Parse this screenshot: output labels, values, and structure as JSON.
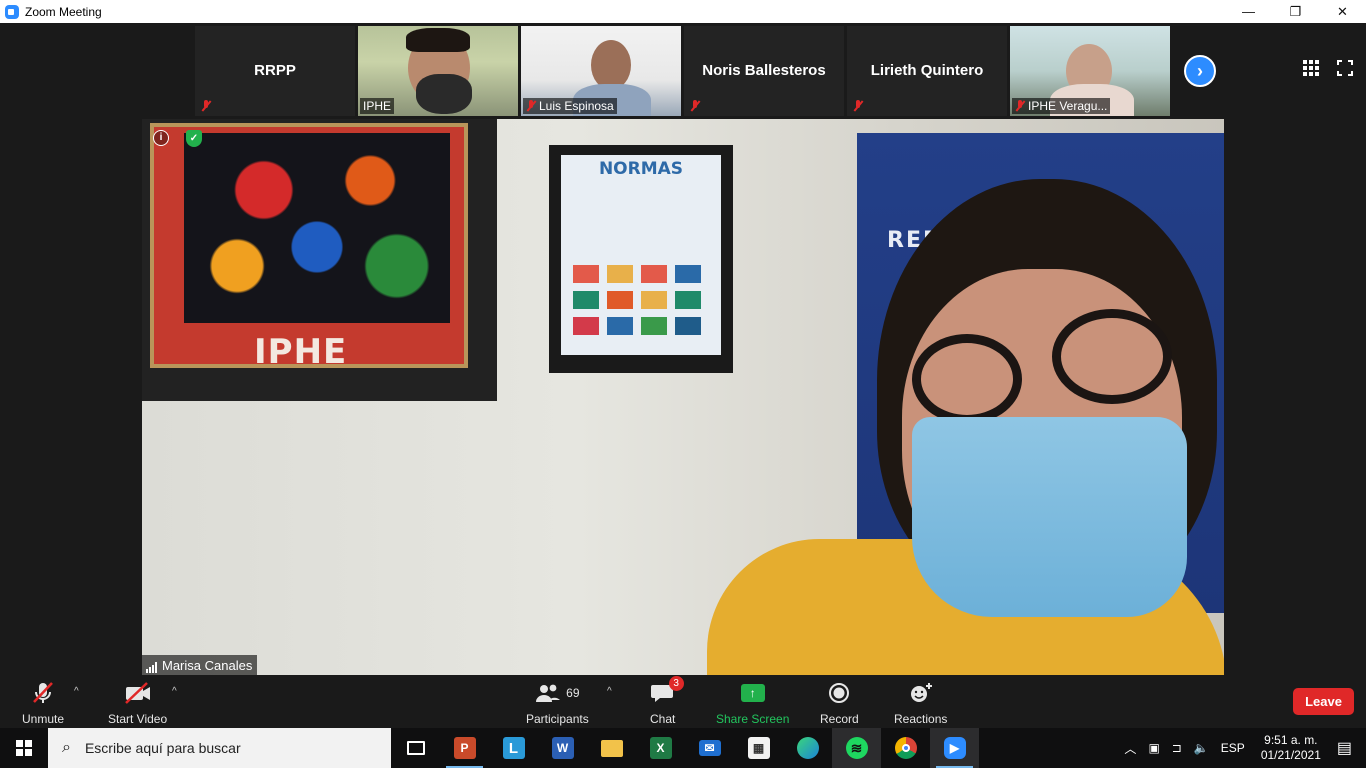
{
  "window": {
    "title": "Zoom Meeting",
    "controls": {
      "minimize": "—",
      "maximize": "❐",
      "close": "✕"
    }
  },
  "thumbnails": [
    {
      "name": "RRPP",
      "label": "",
      "video": false,
      "muted": true
    },
    {
      "name": "",
      "label": "IPHE",
      "video": true,
      "muted": false
    },
    {
      "name": "",
      "label": "Luis Espinosa",
      "video": true,
      "muted": true
    },
    {
      "name": "Noris Ballesteros",
      "label": "",
      "video": false,
      "muted": true
    },
    {
      "name": "Lirieth Quintero",
      "label": "",
      "video": false,
      "muted": true
    },
    {
      "name": "",
      "label": "IPHE Veragu...",
      "video": true,
      "muted": true
    }
  ],
  "speaker": {
    "name": "Marisa Canales",
    "scene": {
      "frame_text": "IPHE",
      "poster_title": "NORMAS",
      "banner_text": "REP          MÁ"
    }
  },
  "toolbar": {
    "unmute": "Unmute",
    "start_video": "Start Video",
    "participants": "Participants",
    "participants_count": "69",
    "chat": "Chat",
    "chat_badge": "3",
    "share_screen": "Share Screen",
    "record": "Record",
    "reactions": "Reactions",
    "leave": "Leave"
  },
  "taskbar": {
    "search_placeholder": "Escribe aquí para buscar",
    "language": "ESP",
    "time": "9:51 a. m.",
    "date": "01/21/2021",
    "apps": [
      "task-view",
      "powerpoint",
      "lexi",
      "word",
      "file-explorer",
      "excel",
      "mail",
      "store",
      "edge",
      "spotify",
      "chrome",
      "zoom"
    ]
  },
  "colors": {
    "zoom_blue": "#2d8cff",
    "leave_red": "#e02828",
    "share_green": "#22b14c",
    "background": "#1a1a1a"
  }
}
